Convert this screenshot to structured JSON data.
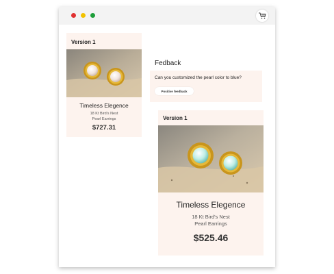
{
  "window": {
    "colors": {
      "close": "#e03131",
      "minimize": "#f2c200",
      "maximize": "#1e9e3a",
      "card_bg": "#fdf3ee"
    },
    "cart_icon": "shopping-cart-icon"
  },
  "version_card_small": {
    "version_label": "Version 1",
    "image": "pearl-earrings-photo",
    "title": "Timeless Elegence",
    "subtitle_line1": "18 Kt Bird's Nest",
    "subtitle_line2": "Pearl Earrings",
    "price": "$727.31"
  },
  "feedback": {
    "title": "Fedback",
    "question": "Can you customized the pearl color to blue?",
    "button_label": "Positive feedback"
  },
  "version_card_large": {
    "version_label": "Version 1",
    "image": "blue-pearl-earrings-photo",
    "title": "Timeless Elegence",
    "subtitle_line1": "18 Kt Bird's Nest",
    "subtitle_line2": "Pearl Earrings",
    "price": "$525.46"
  }
}
